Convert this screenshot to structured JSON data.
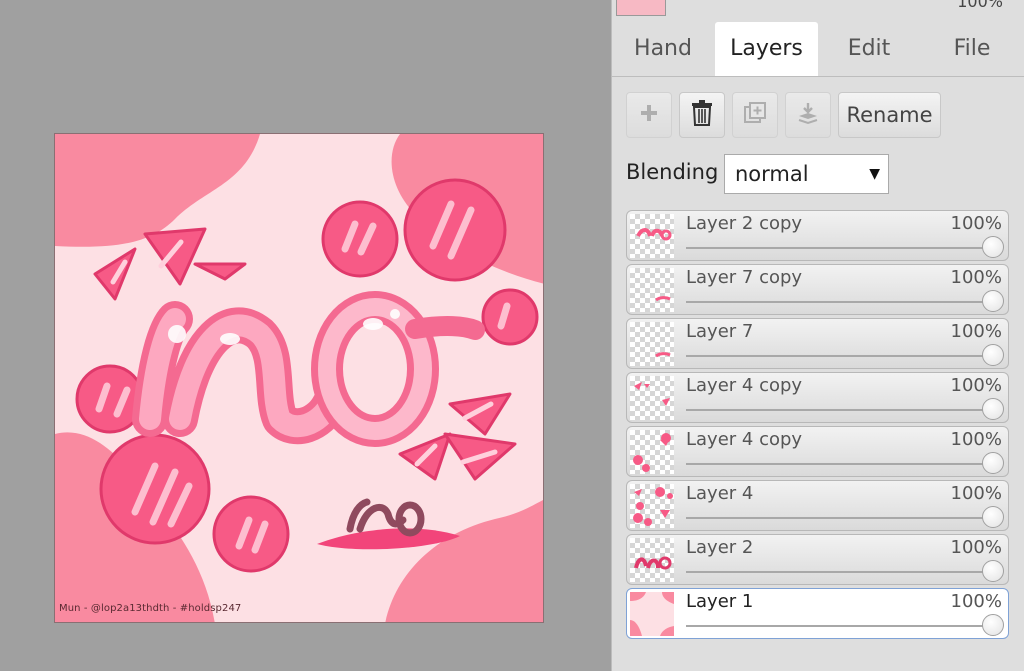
{
  "canvas": {
    "credit": "Mun - @lop2a13thdth - #holdsp247"
  },
  "panel": {
    "top_layer_opacity": "100%",
    "tabs": [
      {
        "label": "Hand"
      },
      {
        "label": "Layers"
      },
      {
        "label": "Edit"
      },
      {
        "label": "File"
      }
    ],
    "active_tab": "Layers",
    "toolbar": {
      "add_icon": "plus-icon",
      "delete_icon": "trash-icon",
      "duplicate_icon": "duplicate-icon",
      "merge_icon": "merge-down-icon",
      "rename_label": "Rename"
    },
    "blending": {
      "label": "Blending",
      "value": "normal"
    },
    "layers": [
      {
        "name": "Layer 2 copy",
        "opacity": "100%",
        "opacity_value": 1.0
      },
      {
        "name": "Layer 7 copy",
        "opacity": "100%",
        "opacity_value": 1.0
      },
      {
        "name": "Layer 7",
        "opacity": "100%",
        "opacity_value": 1.0
      },
      {
        "name": "Layer 4 copy",
        "opacity": "100%",
        "opacity_value": 1.0
      },
      {
        "name": "Layer 4 copy",
        "opacity": "100%",
        "opacity_value": 1.0
      },
      {
        "name": "Layer 4",
        "opacity": "100%",
        "opacity_value": 1.0
      },
      {
        "name": "Layer 2",
        "opacity": "100%",
        "opacity_value": 1.0
      },
      {
        "name": "Layer 1",
        "opacity": "100%",
        "opacity_value": 1.0,
        "selected": true
      }
    ]
  },
  "colors": {
    "canvas_bg": "#fde0e4",
    "blob_pink": "#f98aa0",
    "bubble_pink": "#f75a86",
    "workspace_gray": "#a0a0a0",
    "panel_bg": "#dedede",
    "selected_border": "#7fa2d6"
  }
}
